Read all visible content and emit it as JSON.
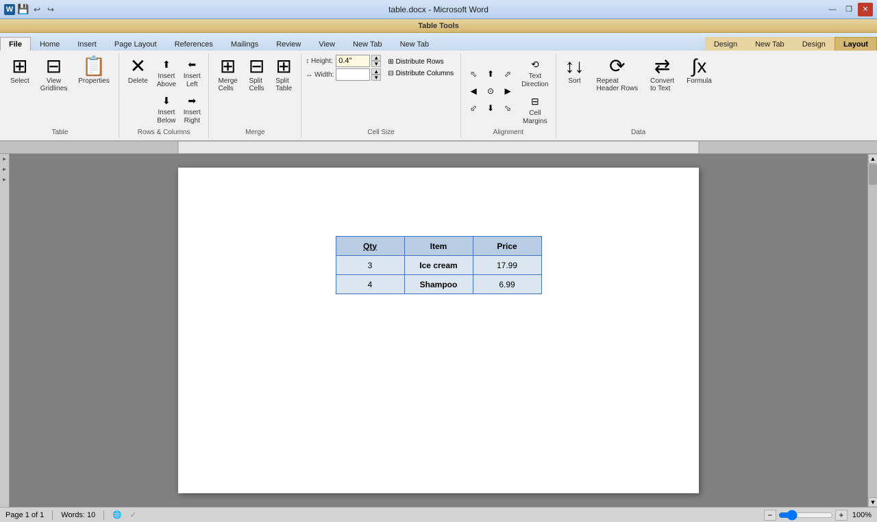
{
  "window": {
    "title": "table.docx - Microsoft Word",
    "tabletools_label": "Table Tools"
  },
  "title_bar": {
    "controls": {
      "minimize": "—",
      "restore": "❐",
      "close": "✕"
    }
  },
  "tabs": {
    "main": [
      "File",
      "Home",
      "Insert",
      "Page Layout",
      "References",
      "Mailings",
      "Review",
      "View",
      "New Tab",
      "New Tab"
    ],
    "tt": [
      "Design",
      "New Tab",
      "Design",
      "Layout"
    ]
  },
  "ribbon": {
    "groups": {
      "table": {
        "label": "Table",
        "select_label": "Select",
        "gridlines_label": "View\nGridlines",
        "properties_label": "Properties"
      },
      "rows_cols": {
        "label": "Rows & Columns",
        "delete_label": "Delete",
        "insert_above_label": "Insert\nAbove",
        "insert_below_label": "Insert\nBelow",
        "insert_left_label": "Insert\nLeft",
        "insert_right_label": "Insert\nRight"
      },
      "merge": {
        "label": "Merge",
        "merge_cells": "Merge\nCells",
        "split_cells": "Split\nCells",
        "split_table": "Split\nTable"
      },
      "cell_size": {
        "label": "Cell Size",
        "height_label": "Height:",
        "height_value": "0.4\"",
        "width_label": "Width:",
        "width_value": "",
        "distribute_rows": "Distribute Rows",
        "distribute_cols": "Distribute Columns",
        "expand_icon": "⊞"
      },
      "alignment": {
        "label": "Alignment",
        "text_direction": "Text\nDirection",
        "cell_margins": "Cell\nMargins"
      },
      "data": {
        "label": "Data",
        "sort": "Sort",
        "repeat_header": "Repeat\nHeader Rows",
        "convert": "Convert\nto Text",
        "formula": "Formula"
      }
    }
  },
  "document": {
    "table": {
      "headers": [
        "Qty",
        "Item",
        "Price"
      ],
      "rows": [
        [
          "3",
          "Ice cream",
          "17.99"
        ],
        [
          "4",
          "Shampoo",
          "6.99"
        ]
      ]
    }
  },
  "status_bar": {
    "page": "Page 1 of 1",
    "words": "Words: 10",
    "language_icon": "🌐",
    "zoom": "100%"
  }
}
